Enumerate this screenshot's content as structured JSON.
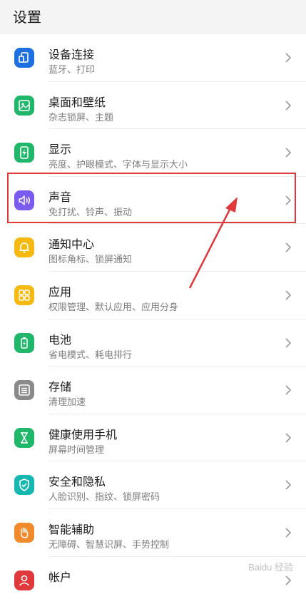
{
  "header": {
    "title": "设置"
  },
  "colors": {
    "accent_blue": "#1e6fe0",
    "accent_green": "#20b76a",
    "accent_purple": "#7b5cf0",
    "accent_yellow": "#f5b90f",
    "accent_teal": "#16b7b0",
    "accent_orange": "#f08a2b",
    "accent_gray": "#8a8a8a",
    "annotation_red": "#e0393b"
  },
  "items": [
    {
      "title": "设备连接",
      "subtitle": "蓝牙、打印",
      "icon": "device-connection-icon"
    },
    {
      "title": "桌面和壁纸",
      "subtitle": "杂志锁屏、主题",
      "icon": "wallpaper-icon"
    },
    {
      "title": "显示",
      "subtitle": "亮度、护眼模式、字体与显示大小",
      "icon": "display-icon"
    },
    {
      "title": "声音",
      "subtitle": "免打扰、铃声、振动",
      "icon": "sound-icon"
    },
    {
      "title": "通知中心",
      "subtitle": "图标角标、锁屏通知",
      "icon": "notification-icon"
    },
    {
      "title": "应用",
      "subtitle": "权限管理、默认应用、应用分身",
      "icon": "apps-icon"
    },
    {
      "title": "电池",
      "subtitle": "省电模式、耗电排行",
      "icon": "battery-icon"
    },
    {
      "title": "存储",
      "subtitle": "清理加速",
      "icon": "storage-icon"
    },
    {
      "title": "健康使用手机",
      "subtitle": "屏幕时间管理",
      "icon": "hourglass-icon"
    },
    {
      "title": "安全和隐私",
      "subtitle": "人脸识别、指纹、锁屏密码",
      "icon": "shield-icon"
    },
    {
      "title": "智能辅助",
      "subtitle": "无障碍、智慧识屏、手势控制",
      "icon": "hand-icon"
    },
    {
      "title": "帐户",
      "subtitle": "",
      "icon": "account-icon"
    }
  ]
}
